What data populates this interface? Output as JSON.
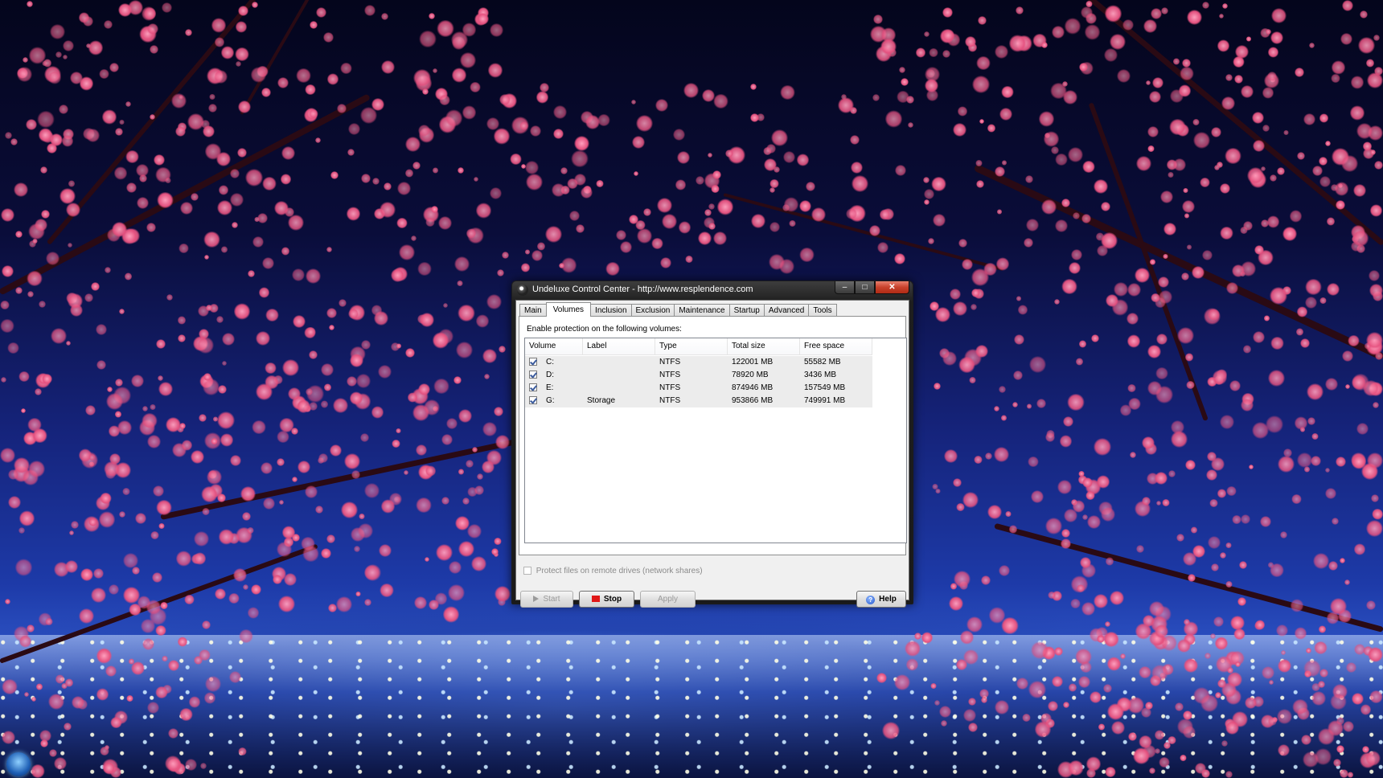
{
  "window": {
    "title": "Undeluxe Control Center - http://www.resplendence.com",
    "caption": {
      "minimize": "–",
      "maximize": "□",
      "close": "✕"
    }
  },
  "tabs": [
    "Main",
    "Volumes",
    "Inclusion",
    "Exclusion",
    "Maintenance",
    "Startup",
    "Advanced",
    "Tools"
  ],
  "active_tab": "Volumes",
  "volumes_panel": {
    "intro": "Enable protection on the following volumes:",
    "columns": [
      "Volume",
      "Label",
      "Type",
      "Total size",
      "Free space"
    ],
    "rows": [
      {
        "checked": true,
        "volume": "C:",
        "label": "",
        "type": "NTFS",
        "total": "122001 MB",
        "free": "55582 MB"
      },
      {
        "checked": true,
        "volume": "D:",
        "label": "",
        "type": "NTFS",
        "total": "78920 MB",
        "free": "3436 MB"
      },
      {
        "checked": true,
        "volume": "E:",
        "label": "",
        "type": "NTFS",
        "total": "874946 MB",
        "free": "157549 MB"
      },
      {
        "checked": true,
        "volume": "G:",
        "label": "Storage",
        "type": "NTFS",
        "total": "953866 MB",
        "free": "749991 MB"
      }
    ],
    "remote_option": {
      "label": "Protect files on remote drives (network shares)",
      "checked": false
    }
  },
  "buttons": {
    "start": "Start",
    "stop": "Stop",
    "apply": "Apply",
    "help": "Help",
    "help_icon_glyph": "?"
  },
  "icons": {
    "app": "undeluxe-app-icon",
    "start": "play-icon",
    "stop": "stop-icon",
    "help": "help-icon",
    "taskbar": "windows-start-orb"
  },
  "colors": {
    "stop_icon": "#e01818",
    "close_button": "#c8412b",
    "title_bar": "#1f1f1f",
    "checkmark": "#3a5a9c"
  }
}
